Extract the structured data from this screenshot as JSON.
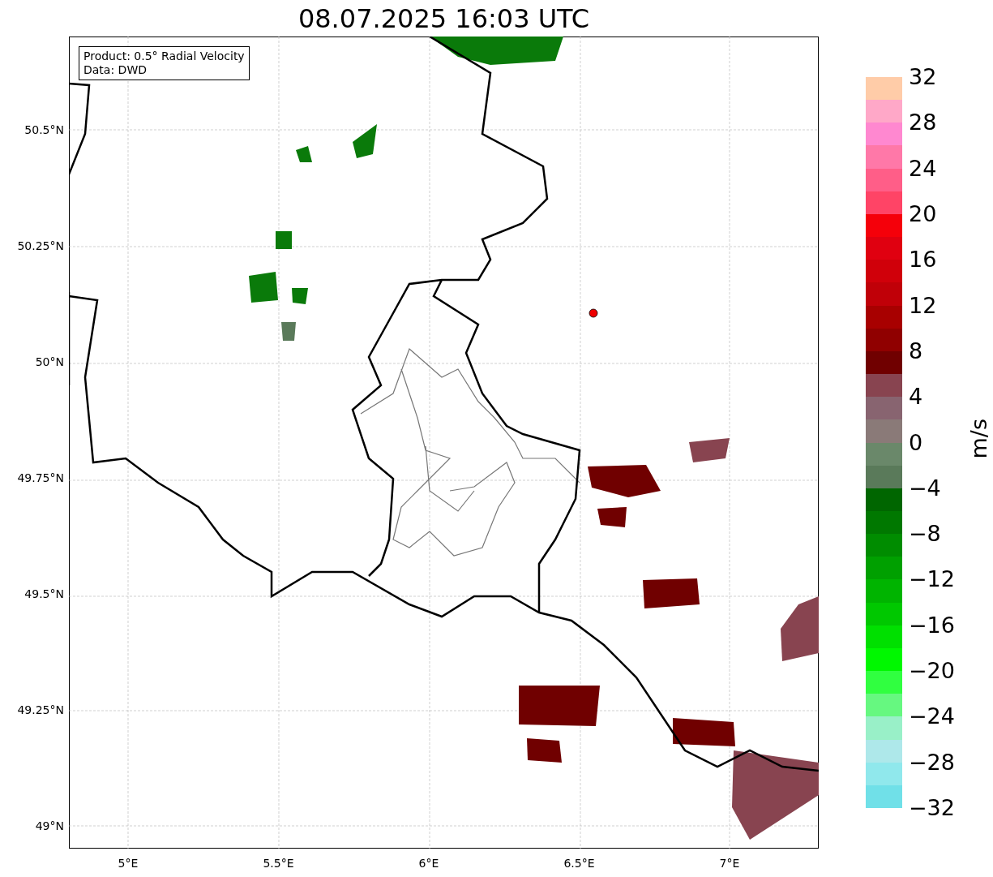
{
  "title": "08.07.2025 16:03 UTC",
  "legend": {
    "lines": [
      "Product: 0.5° Radial Velocity",
      "Data: DWD"
    ]
  },
  "y_ticks": [
    "50.5°N",
    "50.25°N",
    "50°N",
    "49.75°N",
    "49.5°N",
    "49.25°N",
    "49°N"
  ],
  "x_ticks": [
    "5°E",
    "5.5°E",
    "6°E",
    "6.5°E",
    "7°E"
  ],
  "colorbar": {
    "label": "m/s",
    "segments": [
      {
        "color": "#ffcca8"
      },
      {
        "color": "#ffa8c8"
      },
      {
        "color": "#ff88d0"
      },
      {
        "color": "#ff78a8"
      },
      {
        "color": "#ff5e88"
      },
      {
        "color": "#ff4466"
      },
      {
        "color": "#f5000a"
      },
      {
        "color": "#e00010"
      },
      {
        "color": "#d0000a"
      },
      {
        "color": "#c00008"
      },
      {
        "color": "#a80000"
      },
      {
        "color": "#900000"
      },
      {
        "color": "#700000"
      },
      {
        "color": "#884450"
      },
      {
        "color": "#886470"
      },
      {
        "color": "#8a7a78"
      },
      {
        "color": "#6a886a"
      },
      {
        "color": "#5a7a5a"
      },
      {
        "color": "#006600"
      },
      {
        "color": "#007800"
      },
      {
        "color": "#008c00"
      },
      {
        "color": "#00a000"
      },
      {
        "color": "#00b400"
      },
      {
        "color": "#00c800"
      },
      {
        "color": "#00e000"
      },
      {
        "color": "#00f800"
      },
      {
        "color": "#30ff40"
      },
      {
        "color": "#66f880"
      },
      {
        "color": "#99f0c8"
      },
      {
        "color": "#aee8ea"
      },
      {
        "color": "#90e8ec"
      },
      {
        "color": "#70e0e8"
      }
    ],
    "ticks": [
      "32",
      "28",
      "24",
      "20",
      "16",
      "12",
      "8",
      "4",
      "0",
      "−4",
      "−8",
      "−12",
      "−16",
      "−20",
      "−24",
      "−28",
      "−32"
    ]
  }
}
